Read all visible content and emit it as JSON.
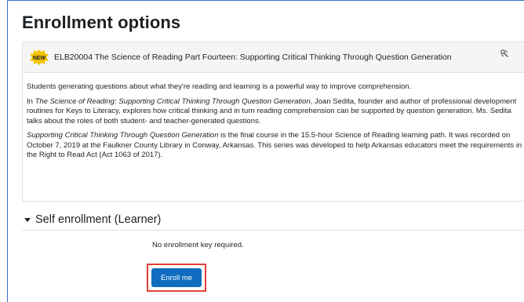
{
  "page": {
    "title": "Enrollment options"
  },
  "course": {
    "badge_text": "NEW",
    "name": "ELB20004 The Science of Reading Part Fourteen: Supporting Critical Thinking Through Question Generation",
    "summary": {
      "p1": "Students generating questions about what they're reading and learning is a powerful way to improve comprehension.",
      "p2_prefix": "In ",
      "p2_italic": "The Science of Reading: Supporting Critical Thinking Through Question Generation",
      "p2_suffix": ", Joan Sedita, founder and author of professional development routines for Keys to Literacy, explores how critical thinking and in turn reading comprehension can be supported by question generation. Ms. Sedita talks about the roles of both student- and teacher-generated questions.",
      "p3_italic": "Supporting Critical Thinking Through Question Generation",
      "p3_suffix": " is the final course in the 15.5-hour Science of Reading learning path. It was recorded on October 7, 2019 at the Faulkner County Library in Conway, Arkansas. This series was developed to help Arkansas educators meet the requirements in the Right to Read Act (Act 1063 of 2017)."
    }
  },
  "self_enrollment": {
    "section_title": "Self enrollment (Learner)",
    "no_key_text": "No enrollment key required.",
    "enroll_button_label": "Enroll me"
  },
  "colors": {
    "accent_blue": "#0f6cbf",
    "highlight_red": "#e0403a",
    "badge_yellow": "#f5c400"
  },
  "icons": {
    "badge": "new-badge-icon",
    "course_tools": "gear-tools-icon",
    "section_caret": "caret-down-icon"
  }
}
